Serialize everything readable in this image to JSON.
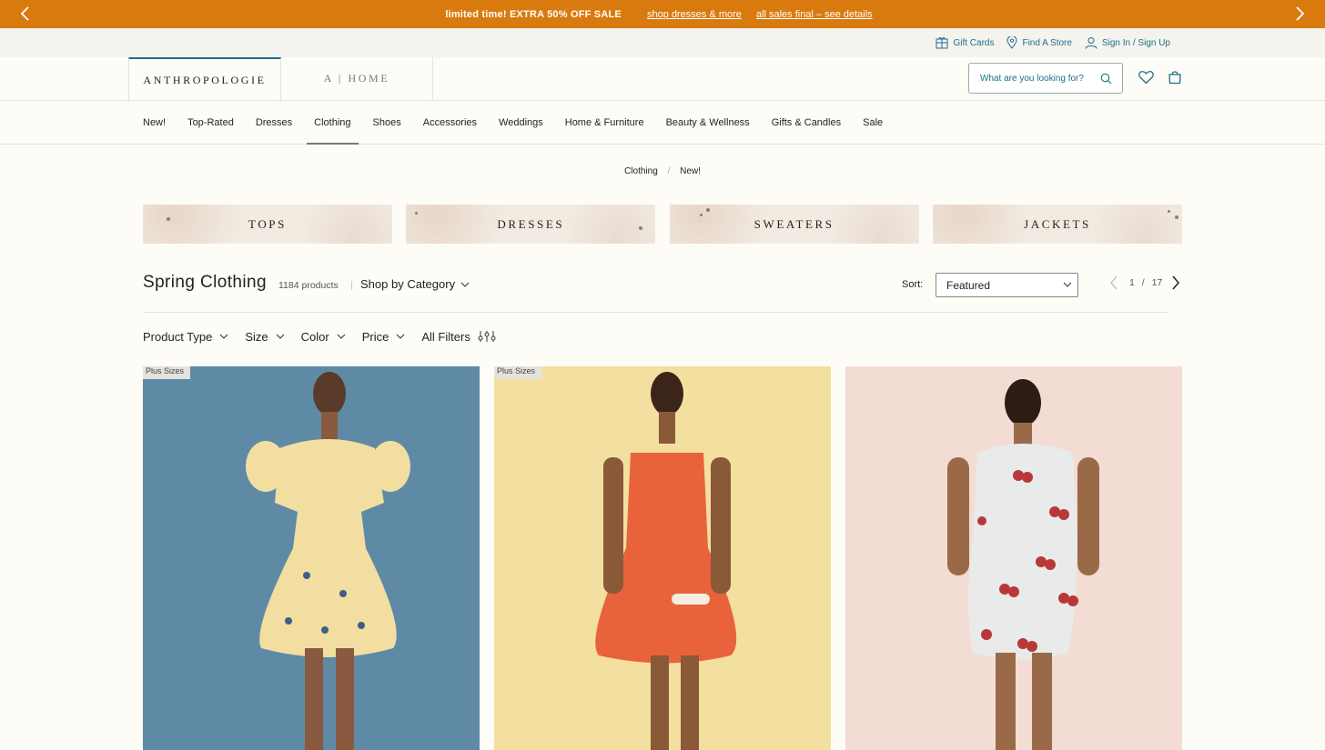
{
  "promo": {
    "message": "limited time! EXTRA 50% OFF SALE",
    "link1": "shop dresses & more",
    "link2": "all sales final – see details"
  },
  "utility": {
    "gift_cards": "Gift Cards",
    "find_store": "Find A Store",
    "sign_in": "Sign In / Sign Up"
  },
  "header": {
    "brand": "ANTHROPOLOGIE",
    "home_brand": "A | HOME",
    "search_placeholder": "What are you looking for?"
  },
  "nav": {
    "items": [
      "New!",
      "Top-Rated",
      "Dresses",
      "Clothing",
      "Shoes",
      "Accessories",
      "Weddings",
      "Home & Furniture",
      "Beauty & Wellness",
      "Gifts & Candles",
      "Sale"
    ],
    "active": "Clothing"
  },
  "breadcrumb": {
    "parent": "Clothing",
    "separator": "/",
    "current": "New!"
  },
  "categories": [
    "TOPS",
    "DRESSES",
    "SWEATERS",
    "JACKETS"
  ],
  "listing": {
    "title": "Spring Clothing",
    "count": "1184 products",
    "shop_by_category": "Shop by Category",
    "sort_label": "Sort:",
    "sort_value": "Featured",
    "page_current": "1",
    "page_separator": "/",
    "page_total": "17"
  },
  "filters": [
    "Product Type",
    "Size",
    "Color",
    "Price",
    "All Filters"
  ],
  "products": [
    {
      "badge": "Plus Sizes",
      "background": "#5f8aa6",
      "dress_color": "#f1dea0"
    },
    {
      "badge": "Plus Sizes",
      "background": "#f3dfa0",
      "dress_color": "#e8633c"
    },
    {
      "badge": "",
      "background": "#f3dcd4",
      "dress_color": "#e8ebe9"
    }
  ],
  "colors": {
    "promo_bar": "#d97a0f",
    "accent": "#1f6e8c",
    "page_background": "#fdfcf7"
  }
}
